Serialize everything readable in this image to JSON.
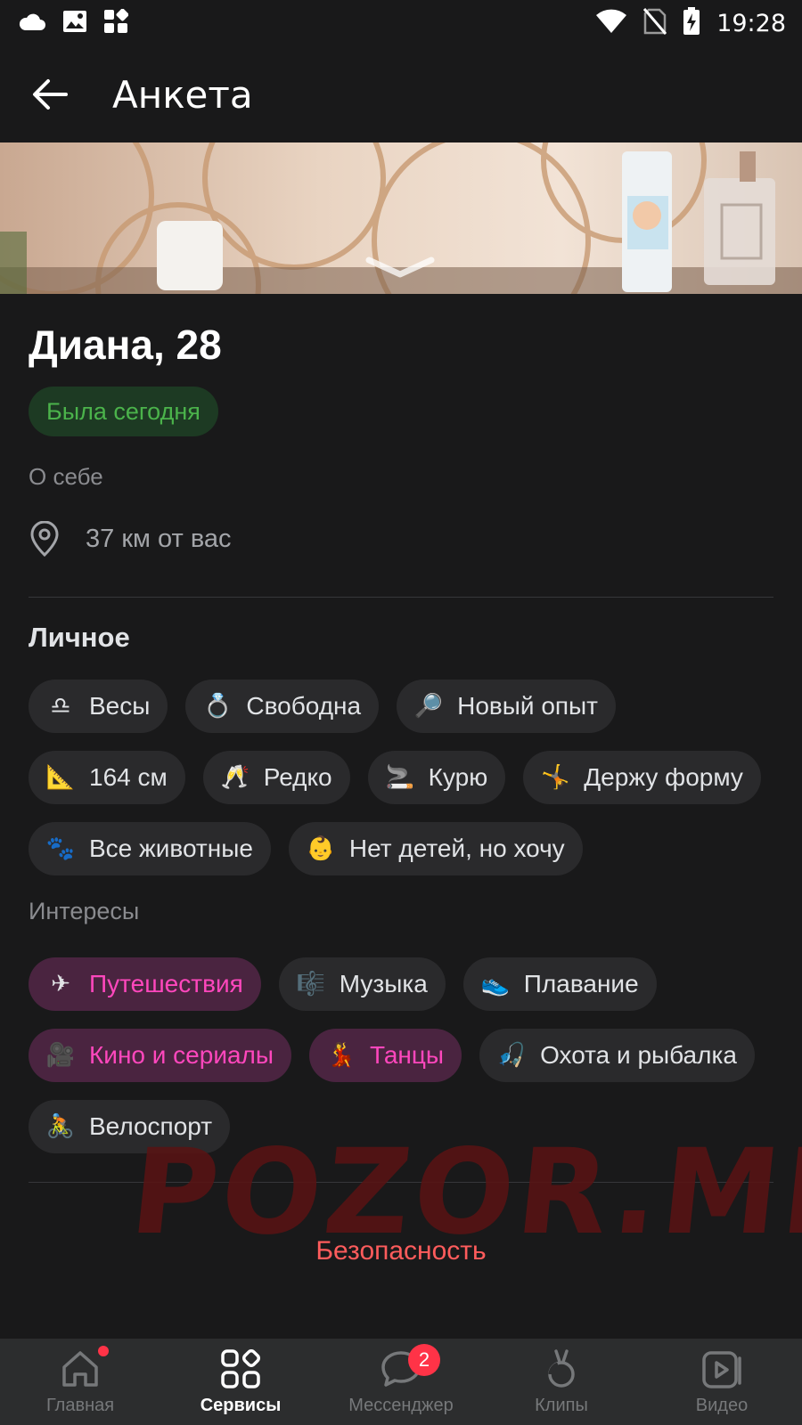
{
  "status_bar": {
    "time": "19:28",
    "icons_left": [
      "cloud-icon",
      "image-icon",
      "apps-icon"
    ],
    "icons_right": [
      "wifi-icon",
      "no-sim-icon",
      "battery-charging-icon"
    ]
  },
  "app_bar": {
    "title": "Анкета"
  },
  "profile": {
    "name_age": "Диана, 28",
    "online_status": "Была сегодня",
    "about_label": "О себе",
    "distance": "37 км от вас"
  },
  "personal": {
    "title": "Личное",
    "chips": [
      {
        "emoji": "♎",
        "label": "Весы"
      },
      {
        "emoji": "💍",
        "label": "Свободна"
      },
      {
        "emoji": "🔎",
        "label": "Новый опыт"
      },
      {
        "emoji": "📐",
        "label": "164 см"
      },
      {
        "emoji": "🥂",
        "label": "Редко"
      },
      {
        "emoji": "🚬",
        "label": "Курю"
      },
      {
        "emoji": "🤸",
        "label": "Держу форму"
      },
      {
        "emoji": "🐾",
        "label": "Все животные"
      },
      {
        "emoji": "👶",
        "label": "Нет детей, но хочу"
      }
    ]
  },
  "interests": {
    "title": "Интересы",
    "chips": [
      {
        "emoji": "✈",
        "label": "Путешествия",
        "active": true
      },
      {
        "emoji": "🎼",
        "label": "Музыка",
        "active": false
      },
      {
        "emoji": "👟",
        "label": "Плавание",
        "active": false
      },
      {
        "emoji": "🎥",
        "label": "Кино и сериалы",
        "active": true
      },
      {
        "emoji": "💃",
        "label": "Танцы",
        "active": true
      },
      {
        "emoji": "🎣",
        "label": "Охота и рыбалка",
        "active": false
      },
      {
        "emoji": "🚴",
        "label": "Велоспорт",
        "active": false
      }
    ]
  },
  "watermark": "POZOR.ME",
  "safety_link": "Безопасность",
  "tabbar": {
    "tabs": [
      {
        "label": "Главная",
        "icon": "home-icon"
      },
      {
        "label": "Сервисы",
        "icon": "services-icon"
      },
      {
        "label": "Мессенджер",
        "icon": "messenger-icon",
        "badge": "2"
      },
      {
        "label": "Клипы",
        "icon": "clips-icon"
      },
      {
        "label": "Видео",
        "icon": "video-icon"
      }
    ]
  },
  "colors": {
    "background": "#19191a",
    "accent_pink": "#ff47bd",
    "online_green": "#4bb34b",
    "danger_red": "#ff5c5c",
    "badge_red": "#ff3347"
  }
}
